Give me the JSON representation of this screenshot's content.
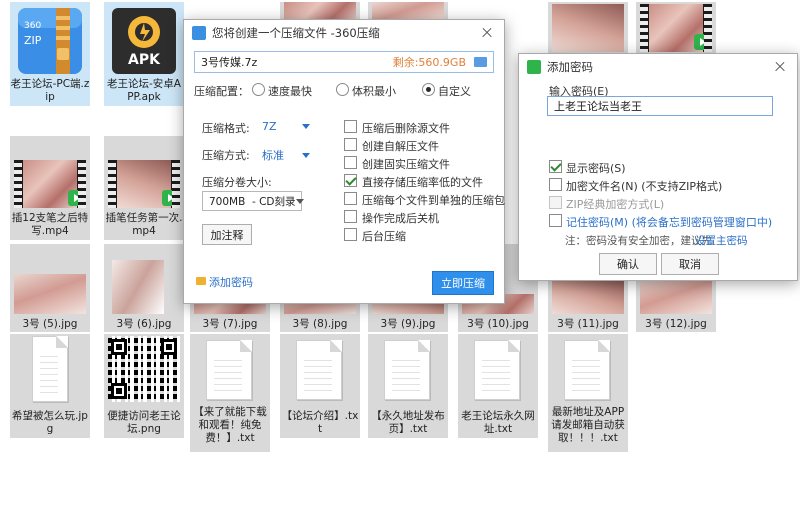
{
  "files": {
    "row1": [
      {
        "label": "老王论坛-PC端.zip"
      },
      {
        "label": "老王论坛-安卓APP.apk",
        "icon_text": "APK"
      }
    ],
    "zip_icon_text": "360\nZIP",
    "row2": [
      {
        "label": "插12支笔之后特写.mp4"
      },
      {
        "label": "插笔任务第一次.mp4"
      }
    ],
    "row3": [
      {
        "label": "3号 (5).jpg"
      },
      {
        "label": "3号 (6).jpg"
      },
      {
        "label": "3号 (7).jpg"
      },
      {
        "label": "3号 (8).jpg"
      },
      {
        "label": "3号 (9).jpg"
      },
      {
        "label": "3号 (10).jpg"
      },
      {
        "label": "3号 (11).jpg"
      },
      {
        "label": "3号 (12).jpg"
      }
    ],
    "row4": [
      {
        "label": "希望被怎么玩.jpg"
      },
      {
        "label": "便捷访问老王论坛.png"
      },
      {
        "label": "【来了就能下载和观看！纯免费！】.txt"
      },
      {
        "label": "【论坛介绍】.txt"
      },
      {
        "label": "【永久地址发布页】.txt"
      },
      {
        "label": "老王论坛永久网址.txt"
      },
      {
        "label": "最新地址及APP请发邮箱自动获取！！！.txt"
      }
    ]
  },
  "compress_dialog": {
    "title": "您将创建一个压缩文件 -360压缩",
    "filename": "3号传媒.7z",
    "free_space": "剩余:560.9GB",
    "config_label": "压缩配置：",
    "config_options": [
      "速度最快",
      "体积最小",
      "自定义"
    ],
    "format_label": "压缩格式:",
    "format_value": "7Z",
    "method_label": "压缩方式:",
    "method_value": "标准",
    "split_label": "压缩分卷大小:",
    "split_value": "700MB  - CD刻录",
    "comment_button": "加注释",
    "options": [
      {
        "label": "压缩后删除源文件",
        "checked": false
      },
      {
        "label": "创建自解压文件",
        "checked": false
      },
      {
        "label": "创建固实压缩文件",
        "checked": false
      },
      {
        "label": "直接存储压缩率低的文件",
        "checked": true
      },
      {
        "label": "压缩每个文件到单独的压缩包",
        "checked": false
      },
      {
        "label": "操作完成后关机",
        "checked": false
      },
      {
        "label": "后台压缩",
        "checked": false
      }
    ],
    "add_password": "添加密码",
    "compress_button": "立即压缩"
  },
  "password_dialog": {
    "title": "添加密码",
    "input_label": "输入密码(E)",
    "password_value": "上老王论坛当老王",
    "show_password": "显示密码(S)",
    "encrypt_names": "加密文件名(N) (不支持ZIP格式)",
    "zip_classic": "ZIP经典加密方式(L)",
    "remember": "记住密码(M) (将会备忘到密码管理窗口中)",
    "note_prefix": "注：密码没有安全加密，建议先",
    "note_link": "设置主密码",
    "ok_button": "确认",
    "cancel_button": "取消"
  },
  "colors": {
    "accent": "#2f8fea",
    "link": "#2a6fc9",
    "check": "#2d8a2d"
  }
}
